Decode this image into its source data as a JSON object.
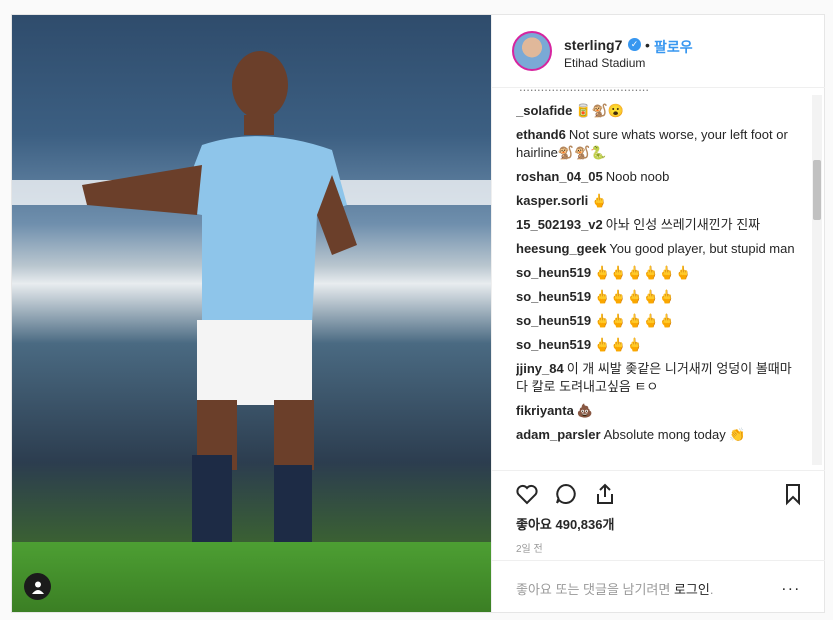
{
  "post": {
    "username": "sterling7",
    "follow_label": "팔로우",
    "dot": "•",
    "location": "Etihad Stadium",
    "likes": "좋아요 490,836개",
    "time": "2일 전",
    "login_prefix": "좋아요 또는 댓글을 남기려면 ",
    "login_link": "로그인",
    "login_suffix": ".",
    "more": "..."
  },
  "comments": [
    {
      "user": "",
      "text": "...................................."
    },
    {
      "user": "_solafide",
      "text": "🥫🐒😮"
    },
    {
      "user": "ethand6",
      "text": "Not sure whats worse, your left foot or hairline🐒🐒🐍"
    },
    {
      "user": "roshan_04_05",
      "text": "Noob noob"
    },
    {
      "user": "kasper.sorli",
      "text": "🖕"
    },
    {
      "user": "15_502193_v2",
      "text": "아놔 인성 쓰레기새낀가 진짜"
    },
    {
      "user": "heesung_geek",
      "text": "You good player, but stupid man"
    },
    {
      "user": "so_heun519",
      "text": "🖕🖕🖕🖕🖕🖕"
    },
    {
      "user": "so_heun519",
      "text": "🖕🖕🖕🖕🖕"
    },
    {
      "user": "so_heun519",
      "text": "🖕🖕🖕🖕🖕"
    },
    {
      "user": "so_heun519",
      "text": "🖕🖕🖕"
    },
    {
      "user": "jjiny_84",
      "text": "이 개 씨발 좆같은 니거새끼 엉덩이 볼때마다 칼로 도려내고싶음 ㅌㅇ"
    },
    {
      "user": "fikriyanta",
      "text": "💩"
    },
    {
      "user": "adam_parsler",
      "text": "Absolute mong today 👏"
    }
  ],
  "icons": {
    "like": "heart-icon",
    "comment": "comment-icon",
    "share": "share-icon",
    "save": "bookmark-icon",
    "badge": "user-icon",
    "verified": "verified-check-icon"
  },
  "colors": {
    "accent": "#3897f0",
    "text": "#262626",
    "muted": "#999999"
  }
}
